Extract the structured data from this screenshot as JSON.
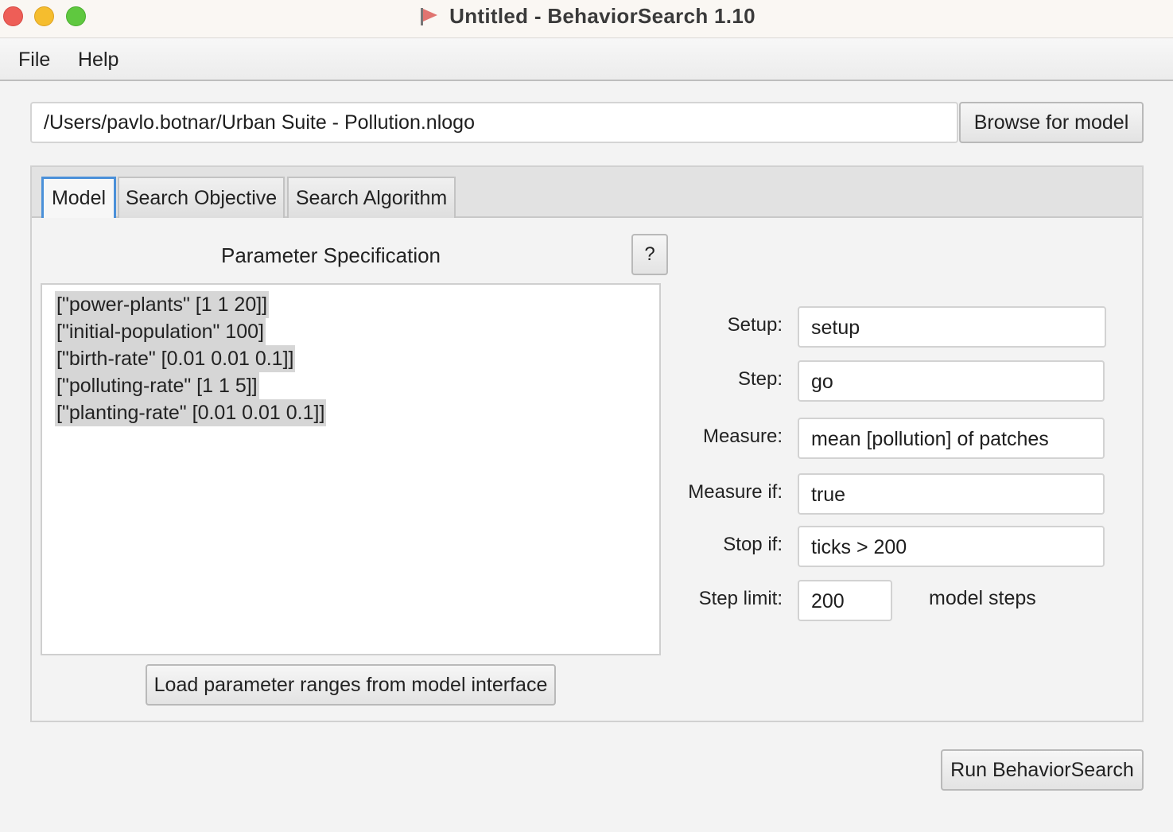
{
  "window": {
    "title": "Untitled - BehaviorSearch 1.10"
  },
  "menu": {
    "file": "File",
    "help": "Help"
  },
  "model": {
    "path": "/Users/pavlo.botnar/Urban Suite - Pollution.nlogo",
    "browse_label": "Browse for model"
  },
  "tabs": [
    {
      "label": "Model",
      "active": true
    },
    {
      "label": "Search Objective",
      "active": false
    },
    {
      "label": "Search Algorithm",
      "active": false
    }
  ],
  "parameters": {
    "title": "Parameter Specification",
    "help_label": "?",
    "lines": [
      "[\"power-plants\" [1 1 20]]",
      "[\"initial-population\" 100]",
      "[\"birth-rate\" [0.01 0.01 0.1]]",
      "[\"polluting-rate\" [1 1 5]]",
      "[\"planting-rate\" [0.01 0.01 0.1]]"
    ],
    "load_label": "Load parameter ranges from model interface"
  },
  "fields": {
    "setup": {
      "label": "Setup:",
      "value": "setup"
    },
    "step": {
      "label": "Step:",
      "value": "go"
    },
    "measure": {
      "label": "Measure:",
      "value": "mean [pollution] of patches"
    },
    "measure_if": {
      "label": "Measure if:",
      "value": "true"
    },
    "stop_if": {
      "label": "Stop if:",
      "value": "ticks > 200"
    },
    "step_limit": {
      "label": "Step limit:",
      "value": "200",
      "units": "model steps"
    }
  },
  "run_label": "Run BehaviorSearch",
  "colors": {
    "tab_accent": "#4a90d9",
    "close": "#ee5e57",
    "minimize": "#f5bd2e",
    "zoom": "#5fc83f"
  }
}
